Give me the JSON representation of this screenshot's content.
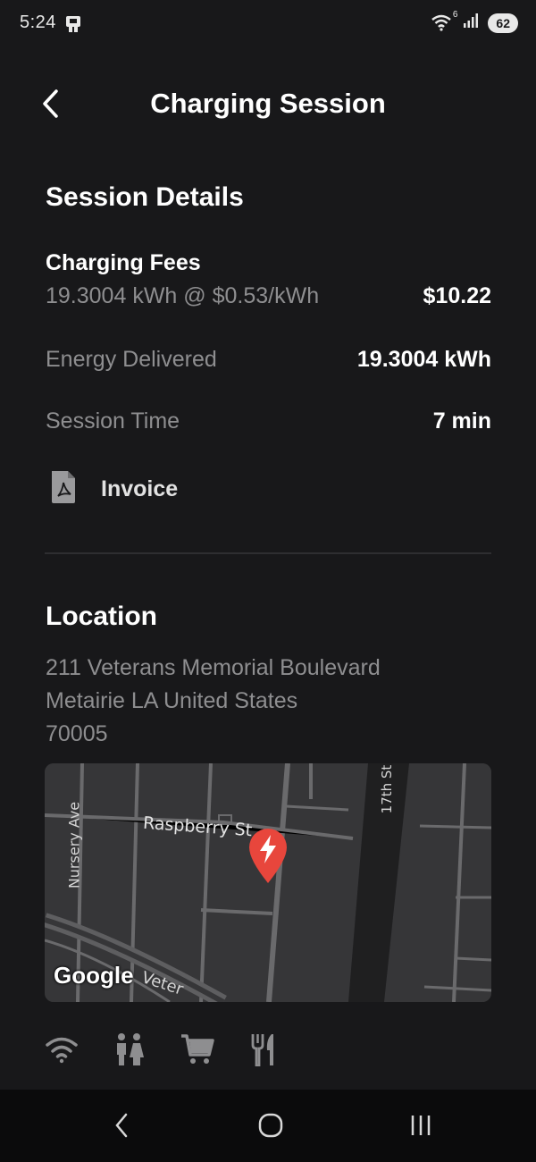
{
  "status_bar": {
    "time": "5:24",
    "battery": "62",
    "wifi_badge": "6"
  },
  "header": {
    "title": "Charging Session"
  },
  "session": {
    "heading": "Session Details",
    "fees_label": "Charging Fees",
    "fees_detail": "19.3004 kWh @ $0.53/kWh",
    "fees_value": "$10.22",
    "energy_label": "Energy Delivered",
    "energy_value": "19.3004 kWh",
    "time_label": "Session Time",
    "time_value": "7 min",
    "invoice_label": "Invoice"
  },
  "location": {
    "heading": "Location",
    "address_line1": "211 Veterans Memorial Boulevard",
    "address_line2": "Metairie LA United States",
    "address_line3": "70005"
  },
  "map": {
    "street_1": "Raspberry St",
    "street_2": "Nursery Ave",
    "street_3": "17th St",
    "street_4": "Veter",
    "logo": "Google",
    "pin_color": "#e8463c"
  },
  "amenities": [
    "wifi-icon",
    "restroom-icon",
    "shopping-cart-icon",
    "restaurant-icon"
  ],
  "colors": {
    "background": "#18181a",
    "muted_text": "#8e8e90"
  }
}
